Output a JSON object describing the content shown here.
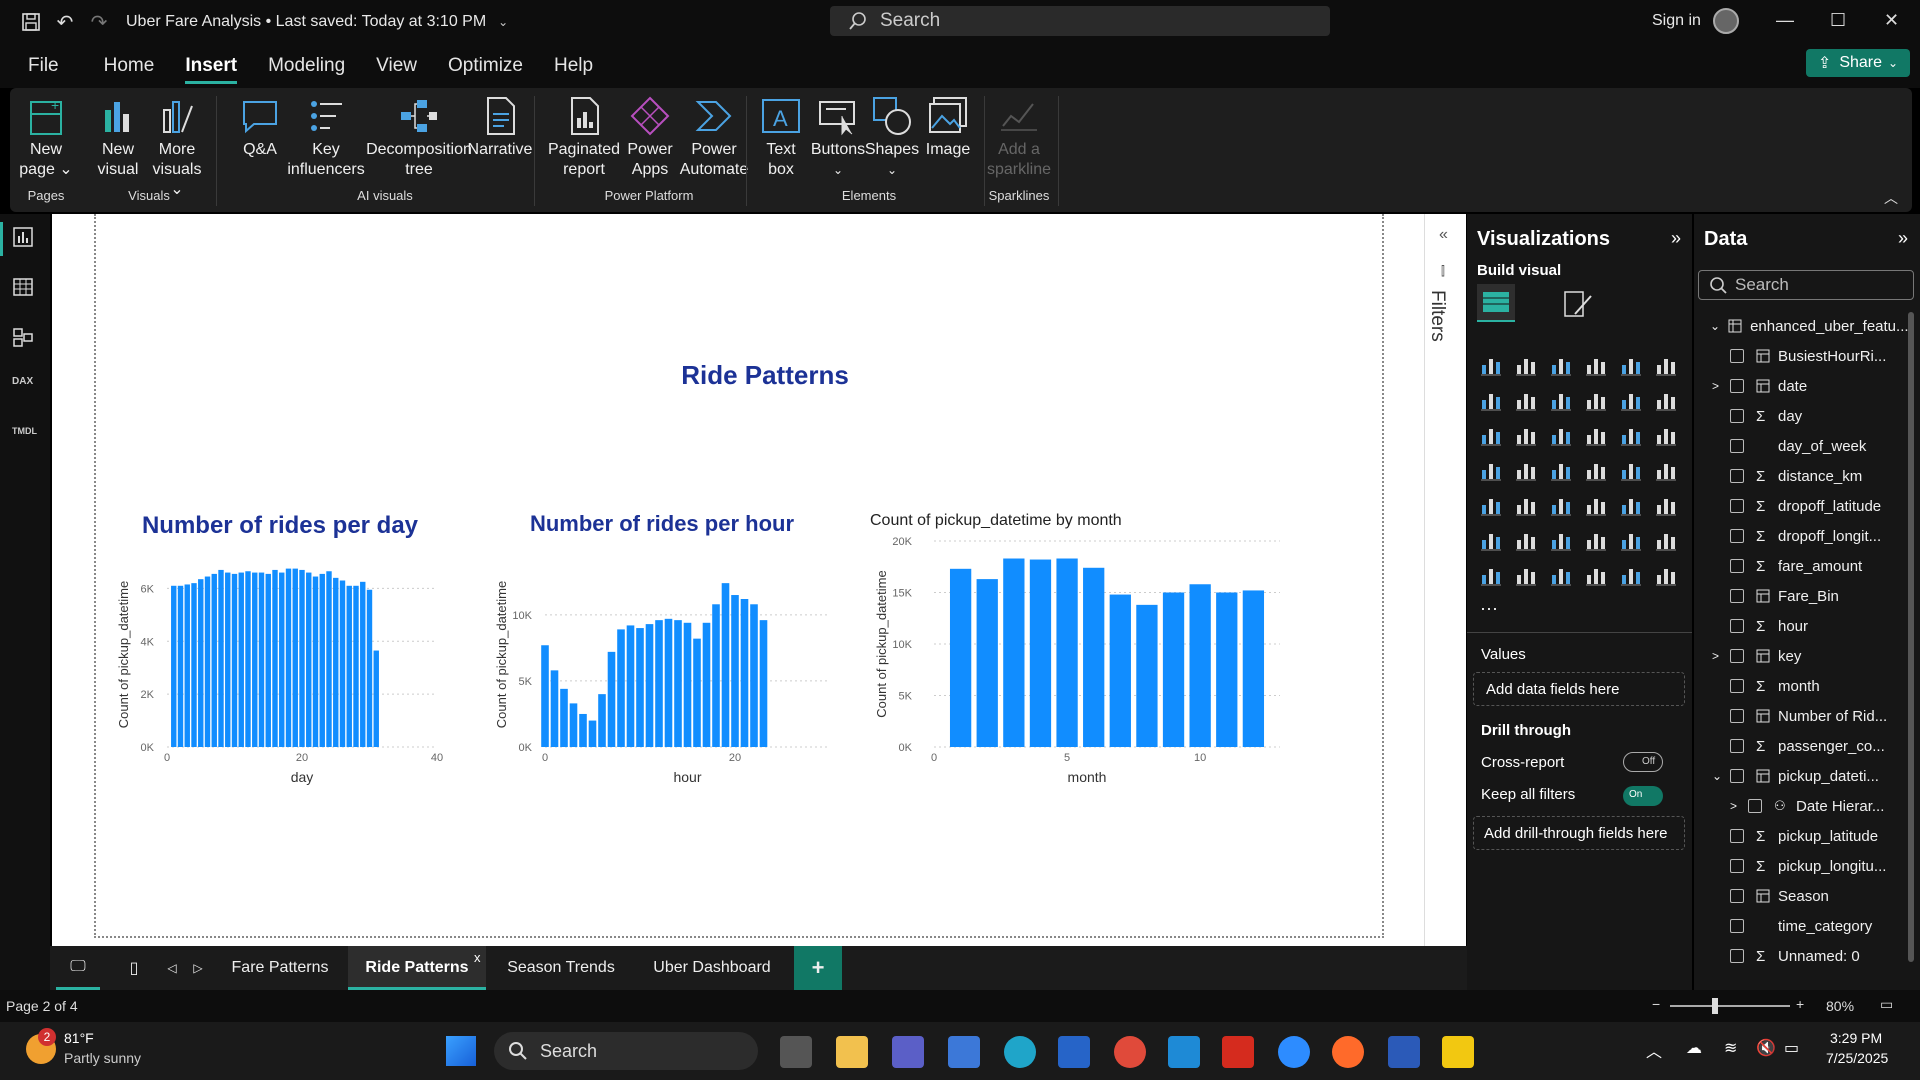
{
  "titlebar": {
    "title": "Uber Fare Analysis • Last saved: Today at 3:10 PM",
    "search": "Search",
    "signin": "Sign in"
  },
  "menu": {
    "items": [
      "File",
      "Home",
      "Insert",
      "Modeling",
      "View",
      "Optimize",
      "Help"
    ],
    "active": "Insert",
    "share": "Share"
  },
  "ribbon": {
    "buttons": [
      {
        "l1": "New",
        "l2": "page",
        "caret": true
      },
      {
        "l1": "New",
        "l2": "visual"
      },
      {
        "l1": "More",
        "l2": "visuals",
        "caret": true
      },
      {
        "l1": "Q&A",
        "l2": ""
      },
      {
        "l1": "Key",
        "l2": "influencers"
      },
      {
        "l1": "Decomposition",
        "l2": "tree"
      },
      {
        "l1": "Narrative",
        "l2": ""
      },
      {
        "l1": "Paginated",
        "l2": "report"
      },
      {
        "l1": "Power",
        "l2": "Apps"
      },
      {
        "l1": "Power",
        "l2": "Automate"
      },
      {
        "l1": "Text",
        "l2": "box"
      },
      {
        "l1": "Buttons",
        "l2": "",
        "caret": true
      },
      {
        "l1": "Shapes",
        "l2": "",
        "caret": true
      },
      {
        "l1": "Image",
        "l2": ""
      },
      {
        "l1": "Add a",
        "l2": "sparkline"
      }
    ],
    "groups": [
      "Pages",
      "Visuals",
      "AI visuals",
      "Power Platform",
      "Elements",
      "Sparklines"
    ]
  },
  "report": {
    "title": "Ride Patterns"
  },
  "chart_data": [
    {
      "type": "bar",
      "title": "Number of rides per day",
      "xlabel": "day",
      "ylabel": "Count of pickup_datetime",
      "x": [
        1,
        2,
        3,
        4,
        5,
        6,
        7,
        8,
        9,
        10,
        11,
        12,
        13,
        14,
        15,
        16,
        17,
        18,
        19,
        20,
        21,
        22,
        23,
        24,
        25,
        26,
        27,
        28,
        29,
        30,
        31
      ],
      "values": [
        6100,
        6100,
        6150,
        6200,
        6350,
        6450,
        6550,
        6700,
        6600,
        6550,
        6600,
        6650,
        6600,
        6600,
        6550,
        6700,
        6600,
        6750,
        6750,
        6700,
        6600,
        6450,
        6550,
        6650,
        6400,
        6300,
        6100,
        6100,
        6250,
        5950,
        3650
      ],
      "xlim": [
        0,
        40
      ],
      "xticks": [
        "0",
        "20",
        "40"
      ],
      "ylim": [
        0,
        7000
      ],
      "yticks": [
        "0K",
        "2K",
        "4K",
        "6K"
      ],
      "grid": true
    },
    {
      "type": "bar",
      "title": "Number of rides per hour",
      "xlabel": "hour",
      "ylabel": "Count of pickup_datetime",
      "x": [
        0,
        1,
        2,
        3,
        4,
        5,
        6,
        7,
        8,
        9,
        10,
        11,
        12,
        13,
        14,
        15,
        16,
        17,
        18,
        19,
        20,
        21,
        22,
        23
      ],
      "values": [
        7700,
        5800,
        4400,
        3300,
        2500,
        2000,
        4000,
        7200,
        8900,
        9200,
        9000,
        9300,
        9600,
        9700,
        9600,
        9400,
        8200,
        9400,
        10800,
        12400,
        11500,
        11200,
        10800,
        9600
      ],
      "xlim": [
        0,
        30
      ],
      "xticks": [
        "0",
        "20"
      ],
      "ylim": [
        0,
        14000
      ],
      "yticks": [
        "0K",
        "5K",
        "10K"
      ],
      "grid": true
    },
    {
      "type": "bar",
      "title": "Count of pickup_datetime by month",
      "xlabel": "month",
      "ylabel": "Count of pickup_datetime",
      "x": [
        1,
        2,
        3,
        4,
        5,
        6,
        7,
        8,
        9,
        10,
        11,
        12
      ],
      "values": [
        17300,
        16300,
        18300,
        18200,
        18300,
        17400,
        14800,
        13800,
        15000,
        15800,
        15000,
        15200
      ],
      "xlim": [
        0,
        13
      ],
      "xticks": [
        "0",
        "5",
        "10"
      ],
      "ylim": [
        0,
        20000
      ],
      "yticks": [
        "0K",
        "5K",
        "10K",
        "15K",
        "20K"
      ],
      "grid": true
    }
  ],
  "filters": {
    "label": "Filters"
  },
  "viz": {
    "title": "Visualizations",
    "build": "Build visual",
    "values_label": "Values",
    "values_placeholder": "Add data fields here",
    "drill": "Drill through",
    "cross": "Cross-report",
    "cross_state": "Off",
    "keep": "Keep all filters",
    "keep_state": "On",
    "drill_placeholder": "Add drill-through fields here"
  },
  "data": {
    "title": "Data",
    "search": "Search",
    "table": "enhanced_uber_featu...",
    "fields": [
      {
        "name": "BusiestHourRi...",
        "icon": "table",
        "exp": ""
      },
      {
        "name": "date",
        "icon": "table",
        "exp": ">"
      },
      {
        "name": "day",
        "icon": "sigma",
        "exp": ""
      },
      {
        "name": "day_of_week",
        "icon": "",
        "exp": ""
      },
      {
        "name": "distance_km",
        "icon": "sigma",
        "exp": ""
      },
      {
        "name": "dropoff_latitude",
        "icon": "sigma",
        "exp": ""
      },
      {
        "name": "dropoff_longit...",
        "icon": "sigma",
        "exp": ""
      },
      {
        "name": "fare_amount",
        "icon": "sigma",
        "exp": ""
      },
      {
        "name": "Fare_Bin",
        "icon": "table",
        "exp": ""
      },
      {
        "name": "hour",
        "icon": "sigma",
        "exp": ""
      },
      {
        "name": "key",
        "icon": "table",
        "exp": ">"
      },
      {
        "name": "month",
        "icon": "sigma",
        "exp": ""
      },
      {
        "name": "Number of Rid...",
        "icon": "table",
        "exp": ""
      },
      {
        "name": "passenger_co...",
        "icon": "sigma",
        "exp": ""
      },
      {
        "name": "pickup_dateti...",
        "icon": "table",
        "exp": "v"
      },
      {
        "name": "Date Hierar...",
        "icon": "hier",
        "exp": ">"
      },
      {
        "name": "pickup_latitude",
        "icon": "sigma",
        "exp": ""
      },
      {
        "name": "pickup_longitu...",
        "icon": "sigma",
        "exp": ""
      },
      {
        "name": "Season",
        "icon": "table",
        "exp": ""
      },
      {
        "name": "time_category",
        "icon": "",
        "exp": ""
      },
      {
        "name": "Unnamed: 0",
        "icon": "sigma",
        "exp": ""
      }
    ]
  },
  "tabs": {
    "items": [
      "Fare Patterns",
      "Ride Patterns",
      "Season Trends",
      "Uber Dashboard"
    ],
    "active": "Ride Patterns"
  },
  "status": {
    "page": "Page 2 of 4",
    "zoom": "80%"
  },
  "taskbar": {
    "weather_temp": "81°F",
    "weather_desc": "Partly sunny",
    "badge": "2",
    "search": "Search",
    "time": "3:29 PM",
    "date": "7/25/2025"
  }
}
